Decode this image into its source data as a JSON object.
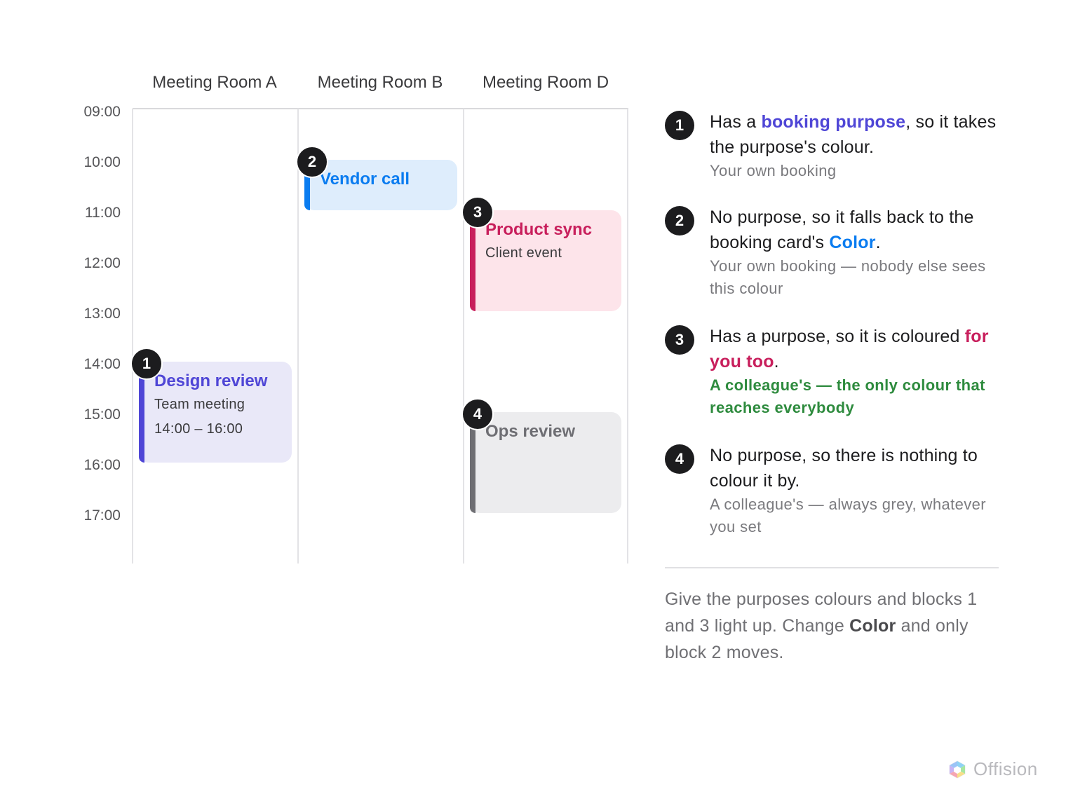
{
  "rooms": [
    "Meeting Room A",
    "Meeting Room B",
    "Meeting Room D"
  ],
  "times": [
    "09:00",
    "10:00",
    "11:00",
    "12:00",
    "13:00",
    "14:00",
    "15:00",
    "16:00",
    "17:00"
  ],
  "events": [
    {
      "badge": "1",
      "title": "Design review",
      "line1": "Team meeting",
      "line2": "14:00 – 16:00",
      "room": "Meeting Room A",
      "start": "14:00",
      "end": "16:00"
    },
    {
      "badge": "2",
      "title": "Vendor call",
      "room": "Meeting Room B",
      "start": "10:00",
      "end": "11:00"
    },
    {
      "badge": "3",
      "title": "Product sync",
      "line1": "Client event",
      "room": "Meeting Room D",
      "start": "11:00",
      "end": "13:00"
    },
    {
      "badge": "4",
      "title": "Ops review",
      "room": "Meeting Room D",
      "start": "15:00",
      "end": "17:00"
    }
  ],
  "legend": [
    {
      "badge": "1",
      "pre": "Has a ",
      "highlight": "booking purpose",
      "post": ", so it takes the purpose's colour.",
      "sub": "Your own booking"
    },
    {
      "badge": "2",
      "pre": "No purpose, so it falls back to the booking card's ",
      "highlight": "Color",
      "post": ".",
      "sub": "Your own booking — nobody else sees this colour"
    },
    {
      "badge": "3",
      "pre": "Has a purpose, so it is coloured ",
      "highlight": "for you too",
      "post": ".",
      "sub": "A colleague's — the only colour that reaches everybody"
    },
    {
      "badge": "4",
      "main": "No purpose, so there is nothing to colour it by.",
      "sub": "A colleague's — always grey, whatever you set"
    }
  ],
  "footnote": {
    "pre": "Give the purposes colours and blocks 1 and 3 light up. Change ",
    "bold": "Color",
    "post": " and only block 2 moves."
  },
  "logo": {
    "text": "Offision"
  },
  "colors": {
    "purpose_indigo": "#4f46d6",
    "card_blue": "#0a7cf0",
    "colleague_pink": "#c81f5c",
    "colleague_green": "#2e8b3e",
    "neutral_grey": "#6e6e73"
  }
}
